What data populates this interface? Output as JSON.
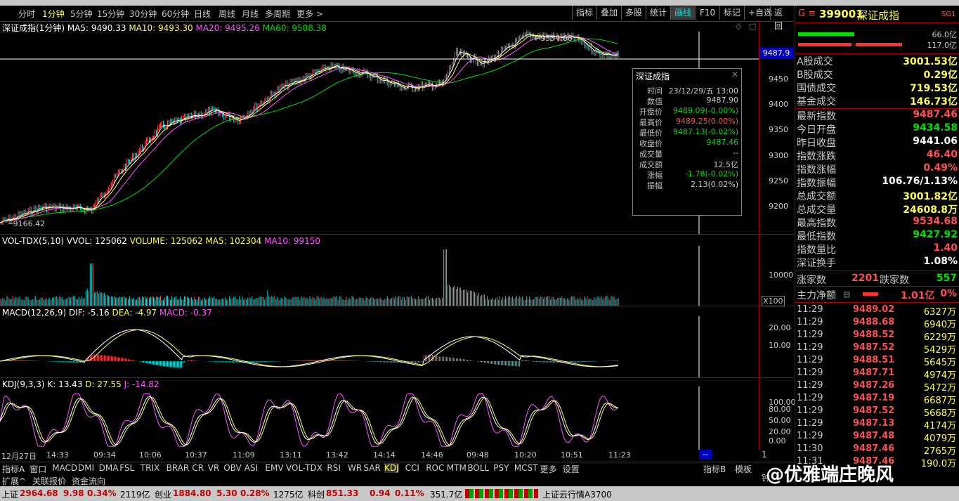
{
  "toolbar": {
    "periods": [
      "分时",
      "1分钟",
      "5分钟",
      "15分钟",
      "30分钟",
      "60分钟",
      "日线",
      "周线",
      "月线",
      "多周期",
      "更多 >"
    ],
    "selected_period": "1分钟",
    "buttons": [
      "指标",
      "叠加",
      "多股",
      "统计",
      "画线",
      "F10",
      "标记",
      "+自选",
      "返回"
    ],
    "active_button": "画线"
  },
  "main_chart": {
    "title": "深证成指(1分钟)",
    "ma5": "MA5: 9490.33",
    "ma10": "MA10: 9493.30",
    "ma20": "MA20: 9495.26",
    "ma60": "MA60: 9508.38",
    "high_label": "9534.68",
    "low_label": "9166.42",
    "cursor_price": "9487.9",
    "y_ticks": [
      "9450",
      "9400",
      "9350",
      "9300",
      "9250",
      "9200"
    ]
  },
  "tooltip": {
    "title": "深证成指",
    "rows": [
      {
        "k": "时间",
        "v": "23/12/29/五 13:00",
        "c": "#c8c8c8"
      },
      {
        "k": "数值",
        "v": "9487.90",
        "c": "#c8c8c8"
      },
      {
        "k": "开盘价",
        "v": "9489.09(-0.00%)",
        "c": "#00e000"
      },
      {
        "k": "最高价",
        "v": "9489.25(0.00%)",
        "c": "#ff5050"
      },
      {
        "k": "最低价",
        "v": "9487.13(-0.02%)",
        "c": "#00e000"
      },
      {
        "k": "收盘价",
        "v": "9487.46",
        "c": "#00e000"
      },
      {
        "k": "成交量",
        "v": "--",
        "c": "#c8c8c8"
      },
      {
        "k": "成交额",
        "v": "12.5亿",
        "c": "#c8c8c8"
      },
      {
        "k": "涨幅",
        "v": "-1.78(-0.02%)",
        "c": "#00e000"
      },
      {
        "k": "振幅",
        "v": "2.13(0.02%)",
        "c": "#c8c8c8"
      }
    ]
  },
  "volume": {
    "header": "VOL-TDX(5,10)",
    "vvol": "VVOL: 125062",
    "volume": "VOLUME: 125062",
    "ma5": "MA5: 102304",
    "ma10": "MA10: 99150",
    "y_tick": "10000",
    "unit": "X100"
  },
  "macd": {
    "header": "MACD(12,26,9)",
    "dif": "DIF: -5.16",
    "dea": "DEA: -4.97",
    "macd": "MACD: -0.37",
    "y_ticks": [
      "20.00",
      "10.00"
    ]
  },
  "kdj": {
    "header": "KDJ(9,3,3)",
    "k": "K: 13.43",
    "d": "D: 27.55",
    "j": "J: -14.82",
    "y_ticks": [
      "100.00",
      "80.00",
      "50.00",
      "20.00",
      "0.00"
    ]
  },
  "xaxis": {
    "labels": [
      "12月27日",
      "14:33",
      "09:34",
      "10:06",
      "10:37",
      "11:09",
      "13:11",
      "13:42",
      "14:14",
      "14:46",
      "09:48",
      "10:20",
      "10:51",
      "11:23"
    ],
    "period": "1分钟",
    "marker": "--"
  },
  "indicator_tabs": [
    "指标A",
    "窗口",
    "MACD",
    "DMI",
    "DMA",
    "FSL",
    "TRIX",
    "BRAR",
    "CR",
    "VR",
    "OBV",
    "ASI",
    "EMV",
    "VOL-TDX",
    "RSI",
    "WR",
    "SAR",
    "KDJ",
    "CCI",
    "ROC",
    "MTM",
    "BOLL",
    "PSY",
    "MCST",
    "更多",
    "设置"
  ],
  "selected_indicator": "KDJ",
  "right_tabs": [
    "指标B",
    "模板"
  ],
  "bottom_tabs": [
    "扩展^",
    "关联报价",
    "资金流向"
  ],
  "right_panel": {
    "code_prefix": "G ≡",
    "code": "399001",
    "name": "深证成指",
    "badge": "SG1",
    "bar1_value": "66.0亿",
    "bar2_value": "117.0亿",
    "stats_a": [
      {
        "k": "A股成交",
        "v": "3001.53亿",
        "c": "#ffff54"
      },
      {
        "k": "B股成交",
        "v": "0.29亿",
        "c": "#ffff54"
      },
      {
        "k": "国债成交",
        "v": "719.53亿",
        "c": "#ffff54"
      },
      {
        "k": "基金成交",
        "v": "146.73亿",
        "c": "#ffff54"
      }
    ],
    "stats_b": [
      {
        "k": "最新指数",
        "v": "9487.46",
        "c": "#ff5050"
      },
      {
        "k": "今日开盘",
        "v": "9434.58",
        "c": "#00e000"
      },
      {
        "k": "昨日收盘",
        "v": "9441.06",
        "c": "#ffffff"
      },
      {
        "k": "指数涨跌",
        "v": "46.40",
        "c": "#ff5050"
      },
      {
        "k": "指数涨幅",
        "v": "0.49%",
        "c": "#ff5050"
      },
      {
        "k": "指数振幅",
        "v": "106.76/1.13%",
        "c": "#ffffff"
      },
      {
        "k": "总成交额",
        "v": "3001.82亿",
        "c": "#ffff54"
      },
      {
        "k": "总成交量",
        "v": "24608.8万",
        "c": "#ffff54"
      },
      {
        "k": "最高指数",
        "v": "9534.68",
        "c": "#ff5050"
      },
      {
        "k": "最低指数",
        "v": "9427.92",
        "c": "#00e000"
      },
      {
        "k": "指数量比",
        "v": "1.40",
        "c": "#ff5050"
      },
      {
        "k": "深证换手",
        "v": "1.08%",
        "c": "#ffffff"
      }
    ],
    "up_label": "涨家数",
    "up_count": "2201",
    "down_label": "跌家数",
    "down_count": "557",
    "main_flow_label": "主力净额",
    "main_flow_value": "1.01亿",
    "main_flow_pct": "0%",
    "trades": [
      {
        "t": "11:29",
        "p": "9489.02",
        "v": "6327万"
      },
      {
        "t": "11:29",
        "p": "9488.68",
        "v": "6940万"
      },
      {
        "t": "11:29",
        "p": "9488.52",
        "v": "6229万"
      },
      {
        "t": "11:29",
        "p": "9487.52",
        "v": "5429万"
      },
      {
        "t": "11:29",
        "p": "9488.51",
        "v": "5645万"
      },
      {
        "t": "11:29",
        "p": "9487.71",
        "v": "4974万"
      },
      {
        "t": "11:29",
        "p": "9487.26",
        "v": "5472万"
      },
      {
        "t": "11:29",
        "p": "9487.19",
        "v": "6687万"
      },
      {
        "t": "11:29",
        "p": "9487.52",
        "v": "5668万"
      },
      {
        "t": "11:29",
        "p": "9487.13",
        "v": "4174万"
      },
      {
        "t": "11:29",
        "p": "9487.48",
        "v": "4079万"
      },
      {
        "t": "11:30",
        "p": "9487.46",
        "v": "2765万"
      },
      {
        "t": "11:31",
        "p": "9487.46",
        "v": "190.0万"
      }
    ]
  },
  "statusbar": {
    "sh_label": "上证",
    "sh_val": "2964.68",
    "sh_chg": "9.98",
    "sh_pct": "0.34%",
    "sh_amt": "2119亿",
    "cy_label": "创业",
    "cy_val": "1884.80",
    "cy_chg": "5.30",
    "cy_pct": "0.28%",
    "cy_amt": "1275亿",
    "kc_label": "科创",
    "kc_val": "851.33",
    "kc_chg": "0.94",
    "kc_pct": "0.11%",
    "kc_amt": "351.7亿",
    "feed": "上证云行情A3700"
  },
  "watermark": "@优雅端庄晚风",
  "colors": {
    "up": "#ff5050",
    "down": "#00e000",
    "ma5": "#ffffff",
    "ma10": "#ffff54",
    "ma20": "#ff54ff",
    "ma60": "#00e000",
    "grid": "#a00000"
  }
}
